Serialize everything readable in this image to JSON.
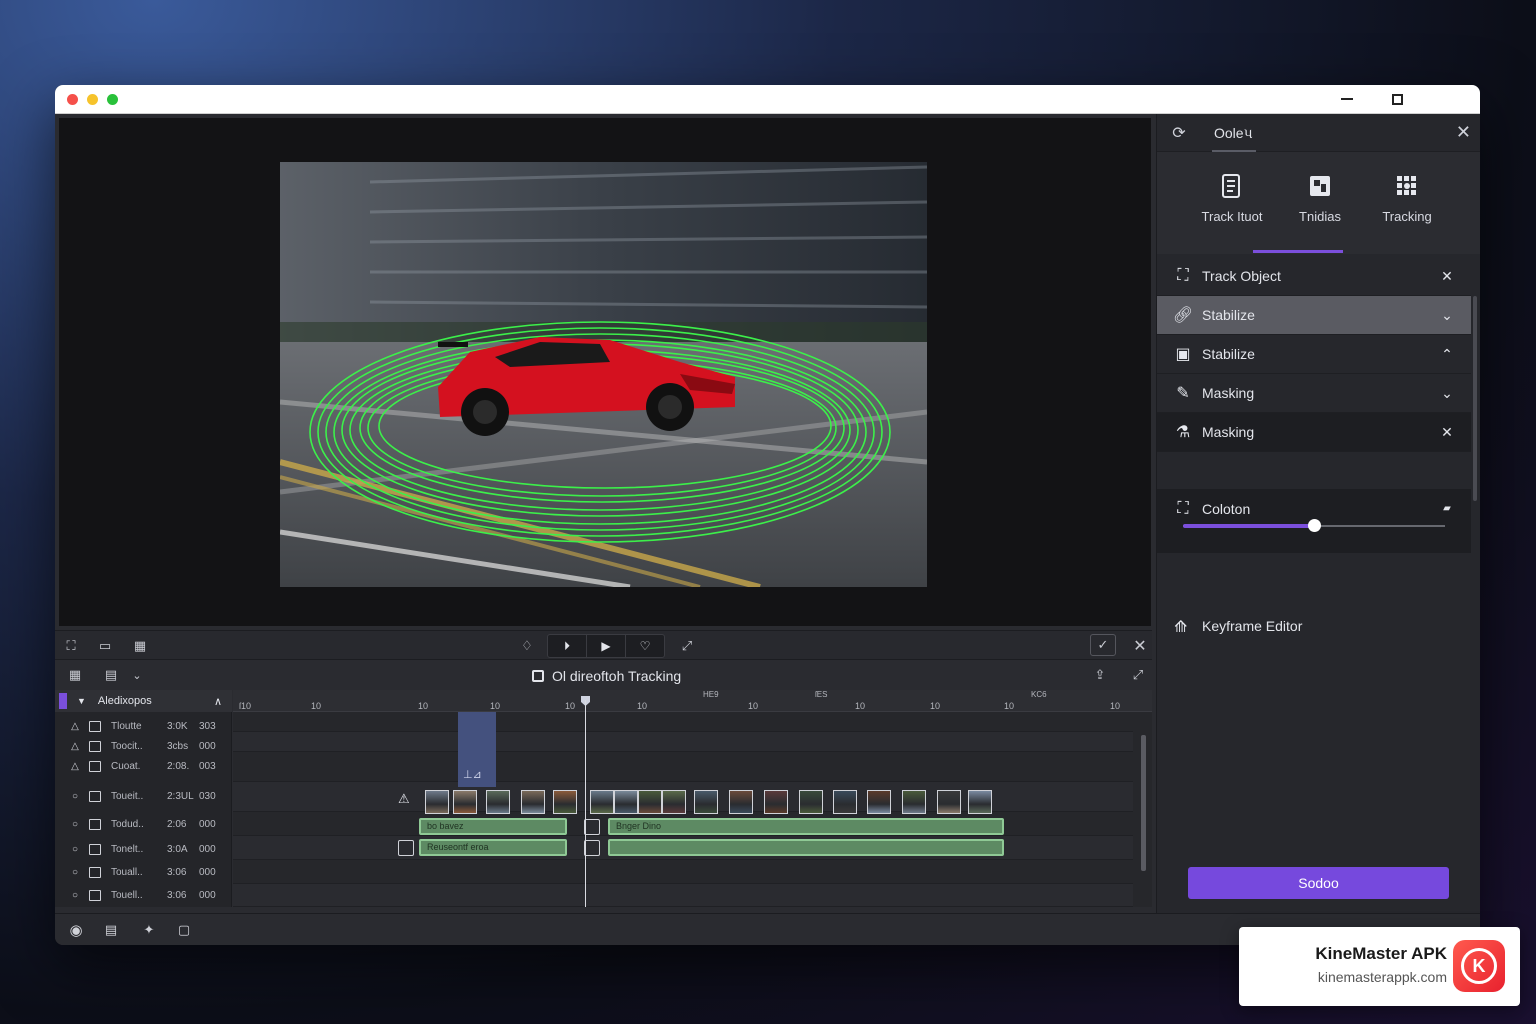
{
  "window": {
    "title_bar_buttons": [
      "minimize",
      "maximize"
    ]
  },
  "panel": {
    "header_title": "Ooleપ",
    "tools": [
      {
        "label": "Track Ituot",
        "icon": "document-icon"
      },
      {
        "label": "Tnidias",
        "icon": "media-icon"
      },
      {
        "label": "Tracking",
        "icon": "tracking-icon"
      }
    ],
    "items": [
      {
        "label": "Track Object",
        "right": "✕",
        "icon": "track-object-icon"
      },
      {
        "label": "Stabilize",
        "right": "⌄",
        "icon": "link-icon"
      },
      {
        "label": "Stabilize",
        "right": "⌃",
        "icon": "camera-icon"
      },
      {
        "label": "Masking",
        "right": "⌄",
        "icon": "eraser-icon"
      },
      {
        "label": "Masking",
        "right": "✕",
        "icon": "flask-icon"
      }
    ],
    "slider": {
      "label": "Coloton",
      "value": 0.5
    },
    "keyframe_label": "Keyframe Editor",
    "action_button": "Sodoo"
  },
  "timeline": {
    "title": "Ol direoftoh Tracking",
    "track_header": "Aledixopos",
    "ruler_labels": [
      "ſ10",
      "10",
      "10",
      "10",
      "10",
      "10",
      "10",
      "10",
      "10",
      "10",
      "10",
      "10"
    ],
    "ruler_top_labels": [
      "HE9",
      "ſES",
      "KC6"
    ],
    "selection_text": "⊥⊿",
    "tracks": [
      {
        "name": "Tloutte",
        "value": "3:0K",
        "extra": "303",
        "icon": "△"
      },
      {
        "name": "Toocit..",
        "value": "3cbs",
        "extra": "000",
        "icon": "△"
      },
      {
        "name": "Cuoat.",
        "value": "2:08.",
        "extra": "003",
        "icon": "△"
      },
      {
        "name": "Toueit..",
        "value": "2:3UL",
        "extra": "030",
        "icon": "○"
      },
      {
        "name": "Todud..",
        "value": "2:06",
        "extra": "000",
        "icon": "○"
      },
      {
        "name": "Tonelt..",
        "value": "3:0A",
        "extra": "000",
        "icon": "○"
      },
      {
        "name": "Touall..",
        "value": "3:06",
        "extra": "000",
        "icon": "○"
      },
      {
        "name": "Touell..",
        "value": "3:06",
        "extra": "000",
        "icon": "○"
      }
    ],
    "clips": [
      {
        "label": "bo bavez"
      },
      {
        "label": "Bnger Dino"
      },
      {
        "label": "Reuseontf eroa"
      },
      {
        "label": ""
      }
    ]
  },
  "badge": {
    "title": "KineMaster APK",
    "url": "kinemasterappk.com",
    "logo_letter": "K"
  },
  "colors": {
    "accent": "#7b4fdc",
    "tracking_ring": "#3cf04a",
    "car": "#d4111f",
    "clip": "#5d8a63"
  }
}
